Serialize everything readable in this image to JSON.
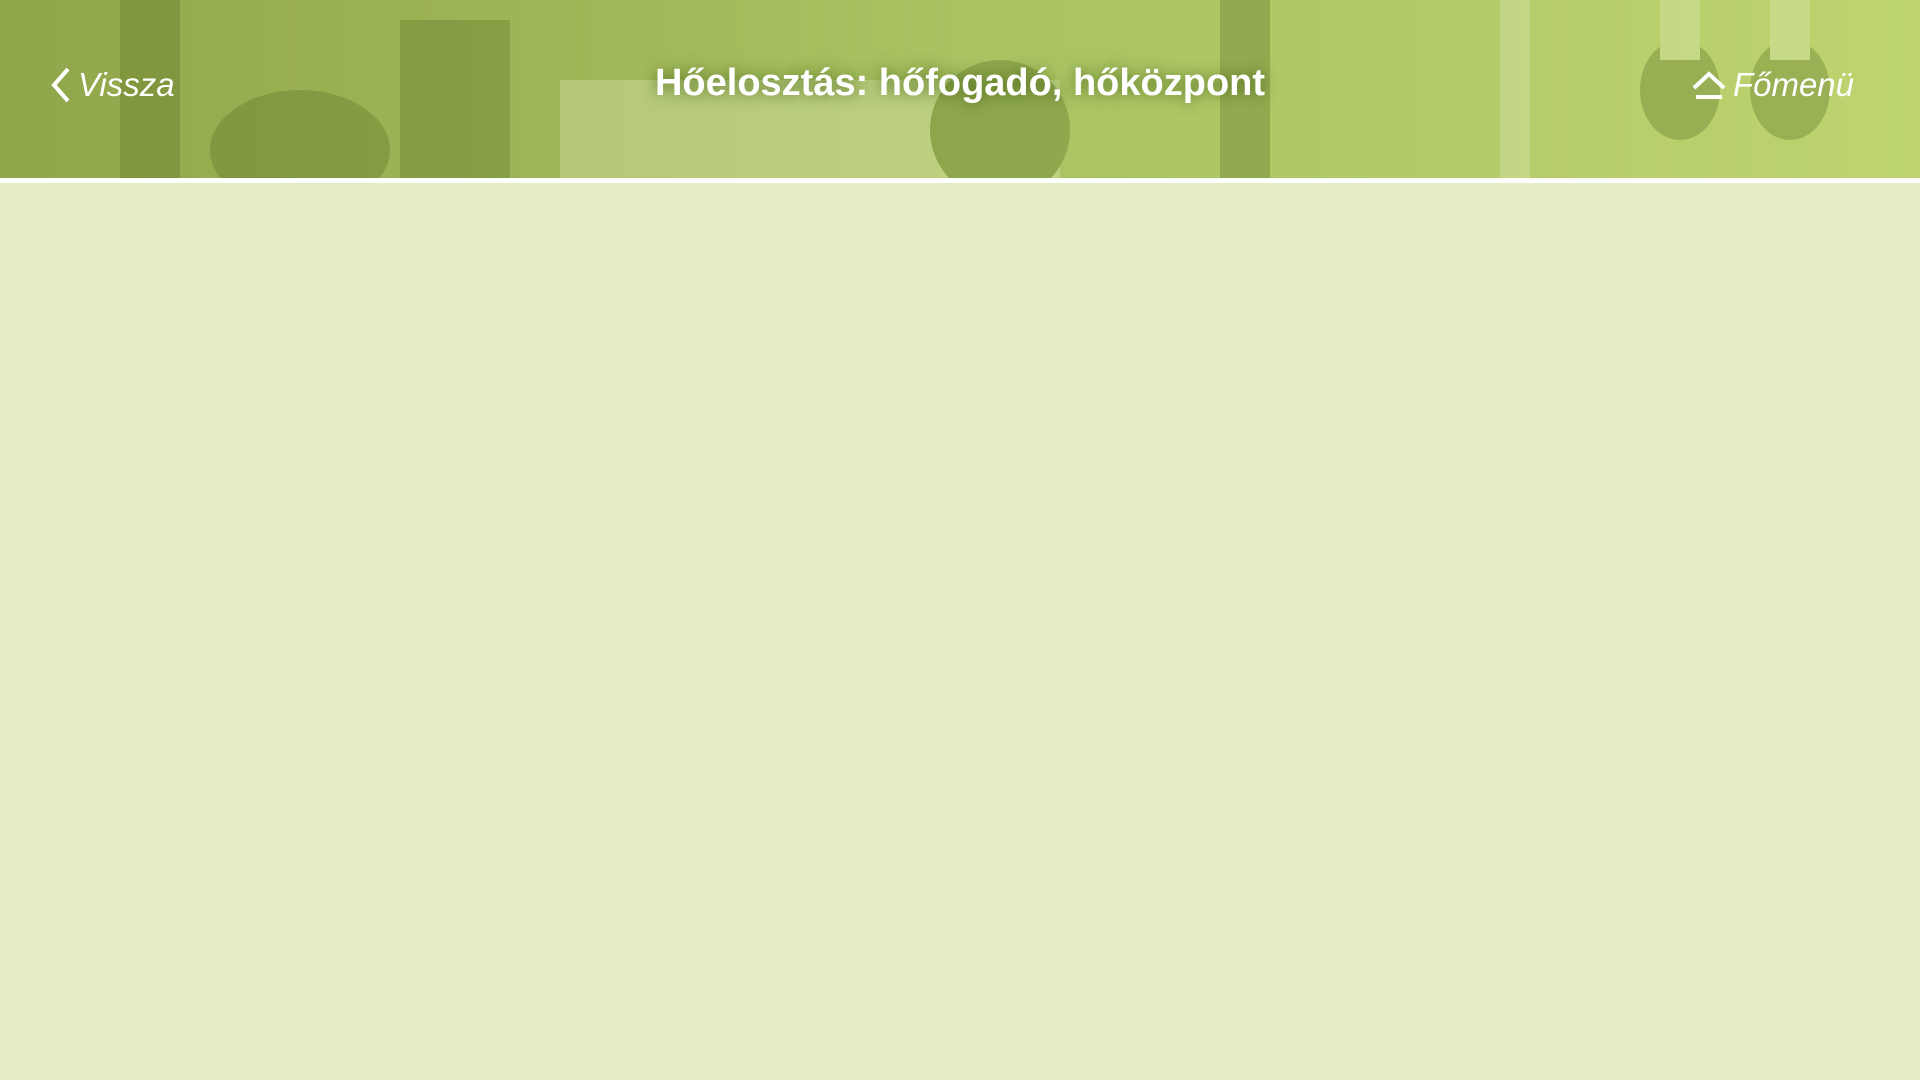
{
  "header": {
    "title": "Hőelosztás: hőfogadó, hőközpont",
    "back_label": "Vissza",
    "home_label": "Főmenü",
    "back_icon": "chevron-left-icon",
    "home_icon": "home-up-icon"
  },
  "colors": {
    "header_bg": "#a9c262",
    "content_bg": "#e4edc6",
    "text": "#ffffff"
  }
}
